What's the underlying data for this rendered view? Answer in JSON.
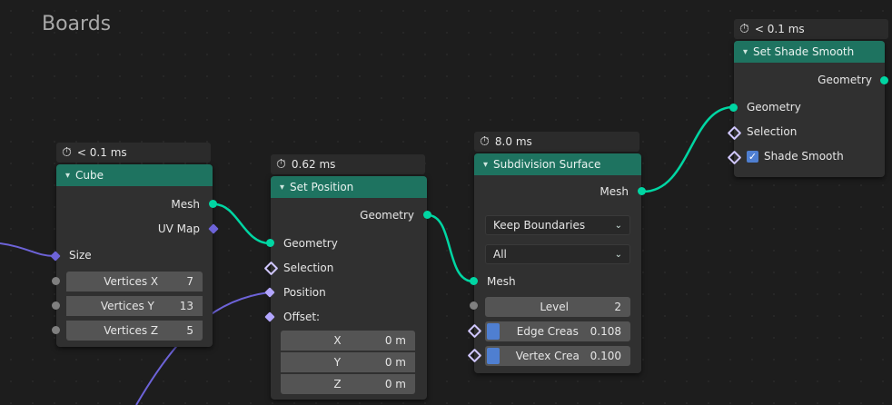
{
  "frame": {
    "title": "Boards"
  },
  "cube": {
    "timing": "< 0.1 ms",
    "title": "Cube",
    "outputs": {
      "mesh": "Mesh",
      "uv_map": "UV Map"
    },
    "inputs": {
      "size": "Size"
    },
    "vertices_x": {
      "label": "Vertices X",
      "value": "7"
    },
    "vertices_y": {
      "label": "Vertices Y",
      "value": "13"
    },
    "vertices_z": {
      "label": "Vertices Z",
      "value": "5"
    }
  },
  "set_position": {
    "timing": "0.62 ms",
    "title": "Set Position",
    "output_geometry": "Geometry",
    "inputs": {
      "geometry": "Geometry",
      "selection": "Selection",
      "position": "Position",
      "offset": "Offset:"
    },
    "offset_x": {
      "label": "X",
      "value": "0 m"
    },
    "offset_y": {
      "label": "Y",
      "value": "0 m"
    },
    "offset_z": {
      "label": "Z",
      "value": "0 m"
    }
  },
  "subdivision": {
    "timing": "8.0 ms",
    "title": "Subdivision Surface",
    "output_mesh": "Mesh",
    "boundary_mode": "Keep Boundaries",
    "uv_mode": "All",
    "input_mesh": "Mesh",
    "level": {
      "label": "Level",
      "value": "2"
    },
    "edge_crease": {
      "label": "Edge Creas",
      "value": "0.108"
    },
    "vertex_crease": {
      "label": "Vertex Crea",
      "value": "0.100"
    }
  },
  "shade_smooth": {
    "timing": "< 0.1 ms",
    "title": "Set Shade Smooth",
    "output_geometry": "Geometry",
    "inputs": {
      "geometry": "Geometry",
      "selection": "Selection",
      "shade_smooth": "Shade Smooth"
    }
  },
  "icons": {
    "clock": "stopwatch-icon",
    "chevron": "chevron-down-icon",
    "check": "checkmark-icon"
  },
  "colors": {
    "header": "#1e7360",
    "geometry_socket": "#00d6a3",
    "vector_socket": "#6d63d8",
    "field_accent": "#4f7fd1"
  }
}
